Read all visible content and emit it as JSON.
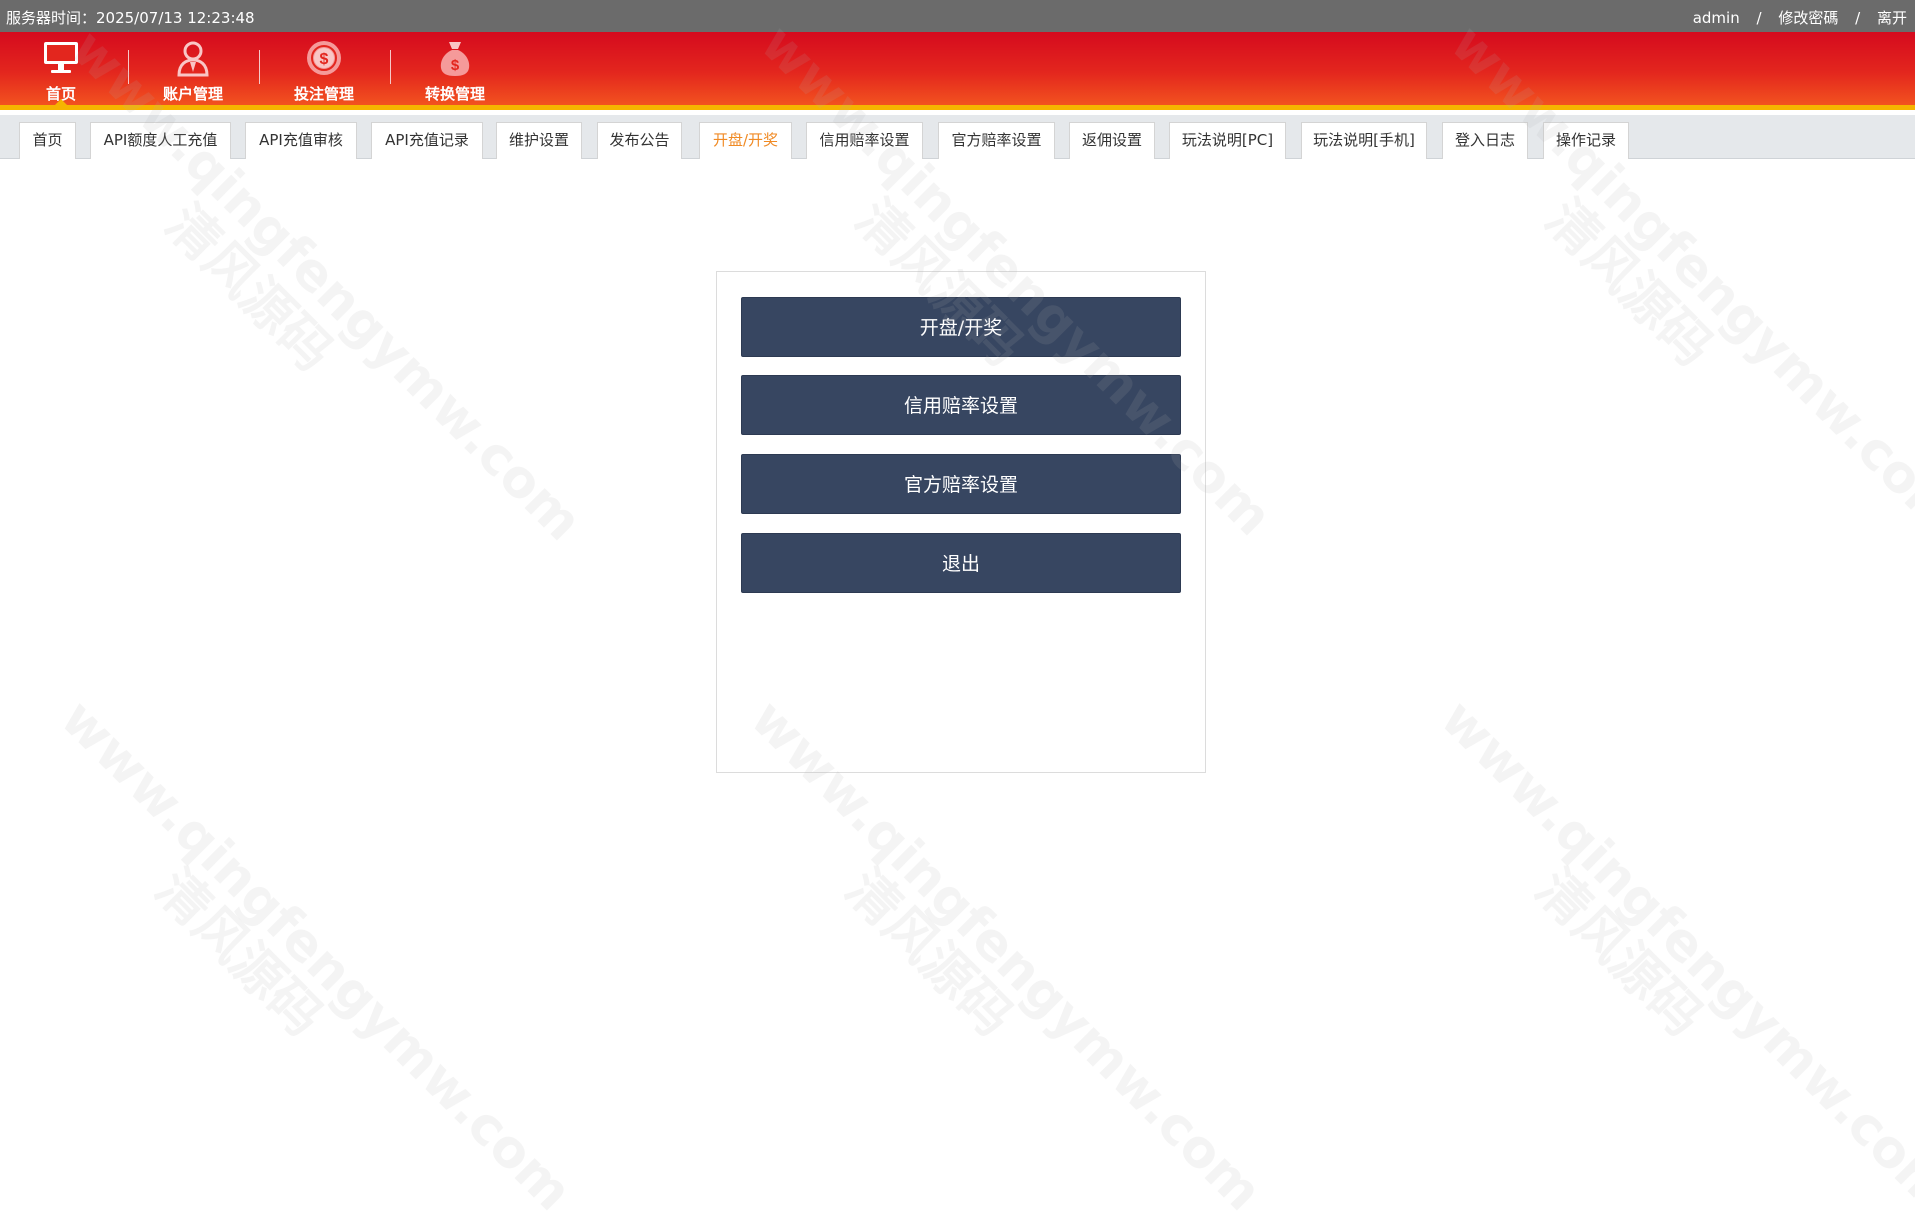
{
  "topbar": {
    "server_time": "服务器时间：2025/07/13 12:23:48",
    "username": "admin",
    "separator": "/",
    "change_password": "修改密碼",
    "logout": "离开"
  },
  "nav": {
    "items": [
      {
        "label": "首页",
        "icon": "monitor-icon"
      },
      {
        "label": "账户管理",
        "icon": "user-icon"
      },
      {
        "label": "投注管理",
        "icon": "dollar-chip-icon"
      },
      {
        "label": "转换管理",
        "icon": "money-bag-icon"
      }
    ],
    "active_index": 0
  },
  "tabs": {
    "items": [
      "首页",
      "API额度人工充值",
      "API充值审核",
      "API充值记录",
      "维护设置",
      "发布公告",
      "开盘/开奖",
      "信用赔率设置",
      "官方赔率设置",
      "返佣设置",
      "玩法说明[PC]",
      "玩法说明[手机]",
      "登入日志",
      "操作记录"
    ],
    "active_index": 6
  },
  "menu": {
    "buttons": [
      "开盘/开奖",
      "信用赔率设置",
      "官方赔率设置",
      "退出"
    ]
  },
  "watermark": {
    "url": "www.qingfengymw.com",
    "brand": "清风源码"
  },
  "colors": {
    "header_red": "#d50a1e",
    "header_orange": "#f2521f",
    "accent_yellow": "#f6b400",
    "active_tab": "#f08a24",
    "button_navy": "#374661"
  }
}
